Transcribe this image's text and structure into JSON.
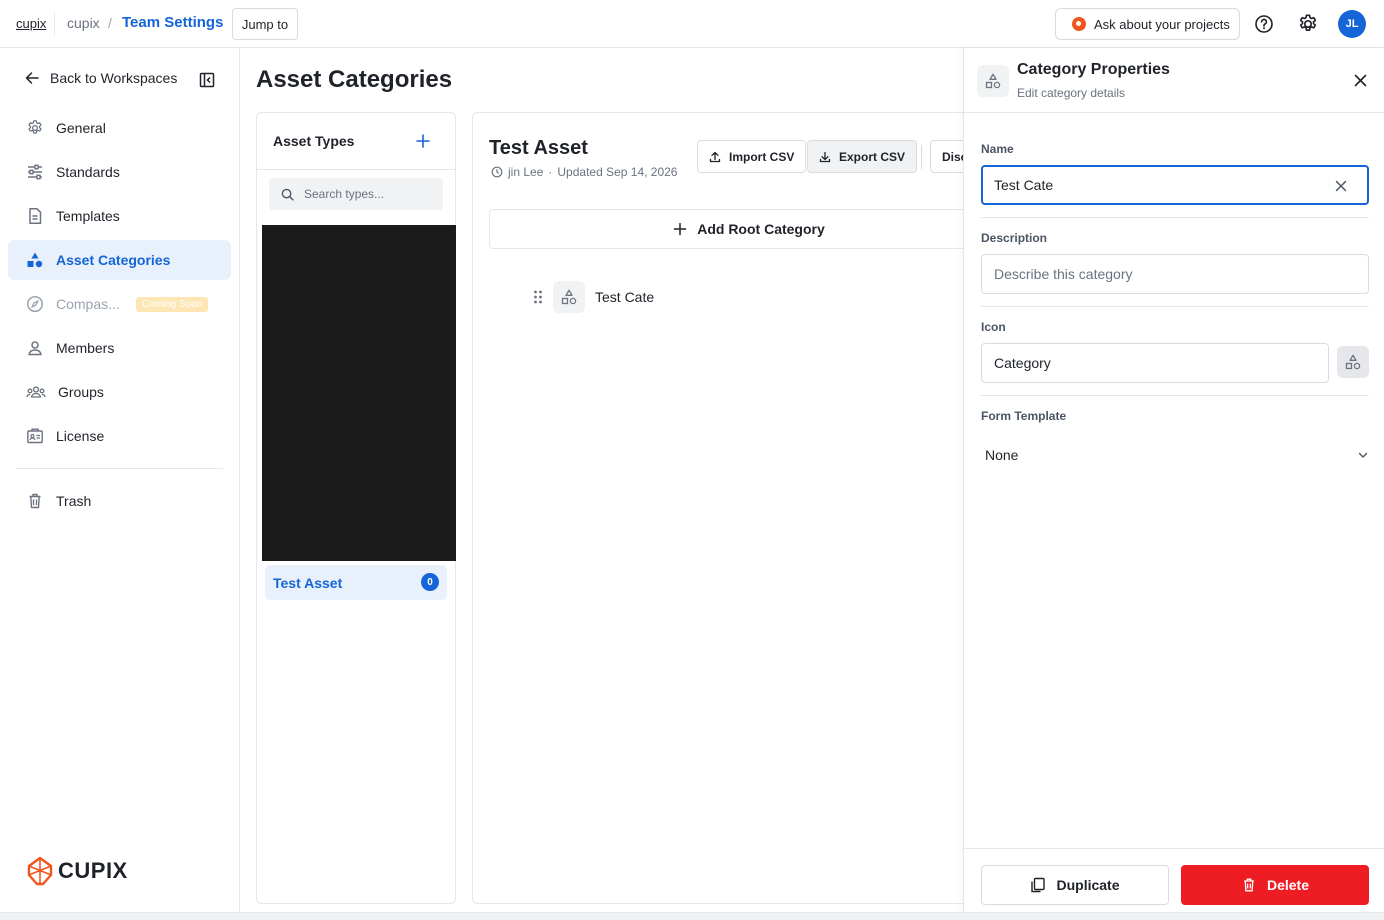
{
  "topbar": {
    "brand": "cupix",
    "workspace": "cupix",
    "separator": "/",
    "page": "Team Settings",
    "jump_label": "Jump to",
    "ask_label": "Ask about your projects",
    "avatar_initials": "JL"
  },
  "sidebar": {
    "back_label": "Back to Workspaces",
    "items": [
      {
        "label": "General",
        "icon": "gear-icon"
      },
      {
        "label": "Standards",
        "icon": "sliders-icon"
      },
      {
        "label": "Templates",
        "icon": "document-icon"
      },
      {
        "label": "Asset Categories",
        "icon": "shapes-icon",
        "active": true
      },
      {
        "label": "Compas...",
        "icon": "compass-icon",
        "badge": "Coming Soon",
        "disabled": true
      },
      {
        "label": "Members",
        "icon": "user-icon"
      },
      {
        "label": "Groups",
        "icon": "group-icon"
      },
      {
        "label": "License",
        "icon": "license-icon"
      }
    ],
    "trash_label": "Trash",
    "logo_text": "CUPIX"
  },
  "main": {
    "title": "Asset Categories",
    "types_panel": {
      "heading": "Asset Types",
      "search_placeholder": "Search types...",
      "items": [
        {
          "label": "Test Asset",
          "count": "0"
        }
      ]
    },
    "detail": {
      "title": "Test Asset",
      "author": "jin Lee",
      "meta_sep": "·",
      "updated": "Updated Sep 14, 2026",
      "import_label": "Import CSV",
      "export_label": "Export CSV",
      "truncated_label": "Disc",
      "add_root_label": "Add Root Category",
      "tree": [
        {
          "label": "Test Cate"
        }
      ]
    }
  },
  "drawer": {
    "title": "Category Properties",
    "subtitle": "Edit category details",
    "name_label": "Name",
    "name_value": "Test Cate",
    "description_label": "Description",
    "description_placeholder": "Describe this category",
    "icon_label": "Icon",
    "icon_value": "Category",
    "form_template_label": "Form Template",
    "form_template_value": "None",
    "duplicate_label": "Duplicate",
    "delete_label": "Delete"
  },
  "colors": {
    "accent": "#1565d8",
    "danger": "#ee1d24",
    "active_bg": "#e8f0fc",
    "badge": "#fde6b3"
  }
}
